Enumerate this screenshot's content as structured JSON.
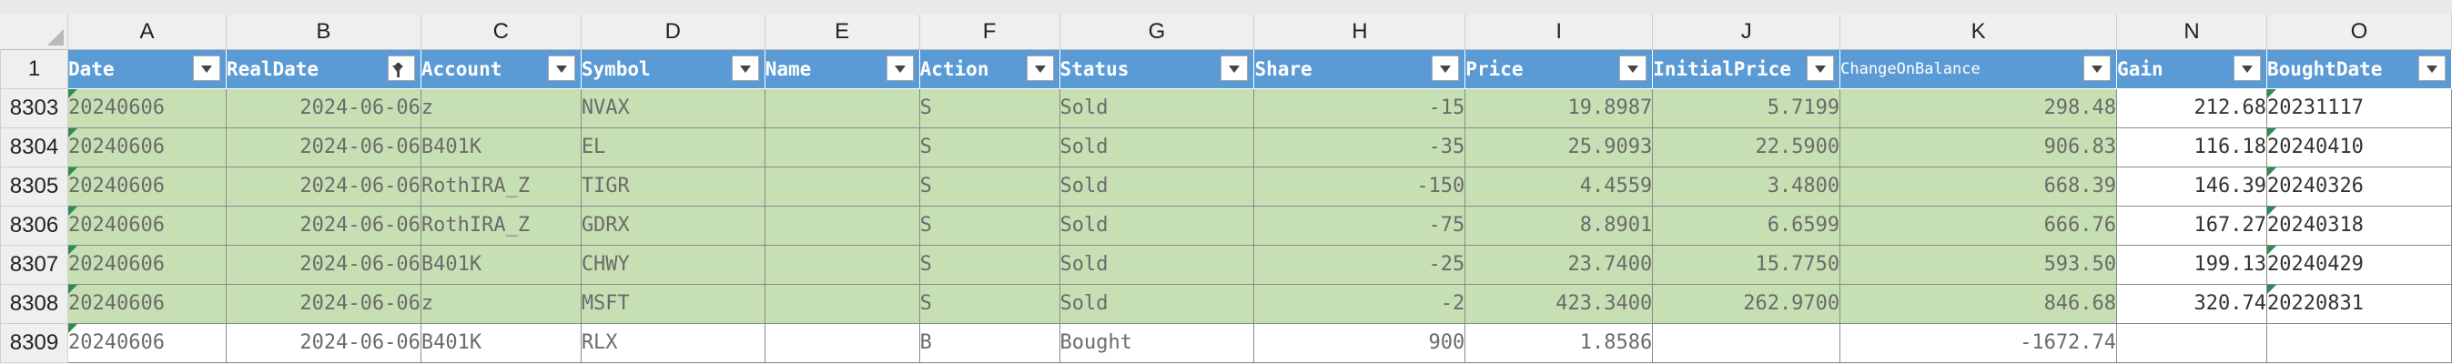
{
  "columns": [
    {
      "letter": "A",
      "header": "Date"
    },
    {
      "letter": "B",
      "header": "RealDate"
    },
    {
      "letter": "C",
      "header": "Account"
    },
    {
      "letter": "D",
      "header": "Symbol"
    },
    {
      "letter": "E",
      "header": "Name"
    },
    {
      "letter": "F",
      "header": "Action"
    },
    {
      "letter": "G",
      "header": "Status"
    },
    {
      "letter": "H",
      "header": "Share"
    },
    {
      "letter": "I",
      "header": "Price"
    },
    {
      "letter": "J",
      "header": "InitialPrice"
    },
    {
      "letter": "K",
      "header": "ChangeOnBalance"
    },
    {
      "letter": "N",
      "header": "Gain"
    },
    {
      "letter": "O",
      "header": "BoughtDate"
    }
  ],
  "header_row_number": "1",
  "rows": [
    {
      "num": "8303",
      "cells": [
        "20240606",
        "2024-06-06",
        "z",
        "NVAX",
        "",
        "S",
        "Sold",
        "-15",
        "19.8987",
        "5.7199",
        "298.48",
        "212.68",
        "20231117"
      ]
    },
    {
      "num": "8304",
      "cells": [
        "20240606",
        "2024-06-06",
        "B401K",
        "EL",
        "",
        "S",
        "Sold",
        "-35",
        "25.9093",
        "22.5900",
        "906.83",
        "116.18",
        "20240410"
      ]
    },
    {
      "num": "8305",
      "cells": [
        "20240606",
        "2024-06-06",
        "RothIRA_Z",
        "TIGR",
        "",
        "S",
        "Sold",
        "-150",
        "4.4559",
        "3.4800",
        "668.39",
        "146.39",
        "20240326"
      ]
    },
    {
      "num": "8306",
      "cells": [
        "20240606",
        "2024-06-06",
        "RothIRA_Z",
        "GDRX",
        "",
        "S",
        "Sold",
        "-75",
        "8.8901",
        "6.6599",
        "666.76",
        "167.27",
        "20240318"
      ]
    },
    {
      "num": "8307",
      "cells": [
        "20240606",
        "2024-06-06",
        "B401K",
        "CHWY",
        "",
        "S",
        "Sold",
        "-25",
        "23.7400",
        "15.7750",
        "593.50",
        "199.13",
        "20240429"
      ]
    },
    {
      "num": "8308",
      "cells": [
        "20240606",
        "2024-06-06",
        "z",
        "MSFT",
        "",
        "S",
        "Sold",
        "-2",
        "423.3400",
        "262.9700",
        "846.68",
        "320.74",
        "20220831"
      ]
    },
    {
      "num": "8309",
      "cells": [
        "20240606",
        "2024-06-06",
        "B401K",
        "RLX",
        "",
        "B",
        "Bought",
        "900",
        "1.8586",
        "",
        "-1672.74",
        "",
        ""
      ]
    }
  ],
  "colors": {
    "header_bg": "#5b9bd5",
    "sold_row_bg": "#c6e0b4",
    "flag": "#2e8b57"
  },
  "sort_indicator_column": "RealDate"
}
